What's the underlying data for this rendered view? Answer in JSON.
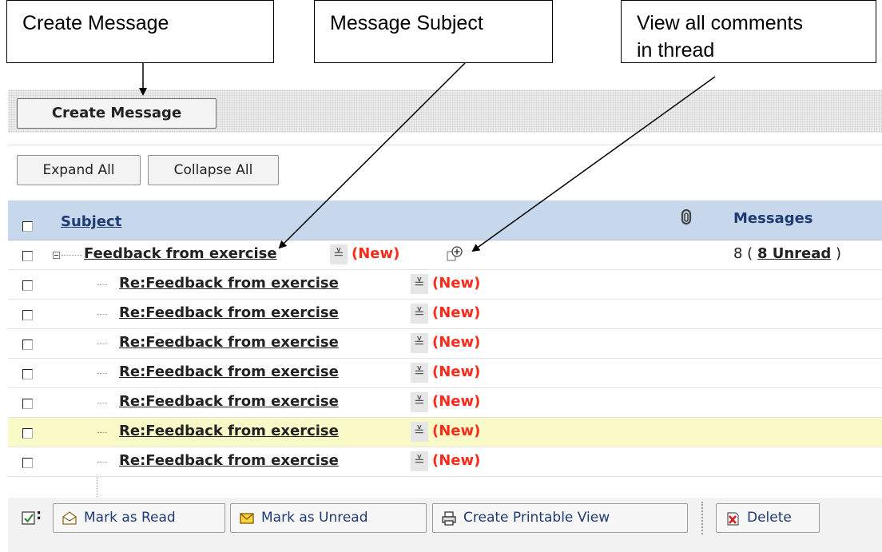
{
  "callouts": {
    "create": "Create Message",
    "subject": "Message Subject",
    "thread_line1": "View all comments",
    "thread_line2": "in thread"
  },
  "toolbar": {
    "create_label": "Create Message",
    "expand_label": "Expand All",
    "collapse_label": "Collapse All"
  },
  "table": {
    "header_subject": "Subject",
    "header_messages": "Messages",
    "attachment_icon": "paperclip-icon",
    "thread": {
      "subject": "Feedback from exercise",
      "new_tag": "(New)",
      "count_prefix": "8 (",
      "unread": "8 Unread",
      "count_suffix": ")"
    },
    "replies": [
      {
        "subject": "Re:Feedback from exercise",
        "new_tag": "(New)"
      },
      {
        "subject": "Re:Feedback from exercise",
        "new_tag": "(New)"
      },
      {
        "subject": "Re:Feedback from exercise",
        "new_tag": "(New)"
      },
      {
        "subject": "Re:Feedback from exercise",
        "new_tag": "(New)"
      },
      {
        "subject": "Re:Feedback from exercise",
        "new_tag": "(New)"
      },
      {
        "subject": "Re:Feedback from exercise",
        "new_tag": "(New)"
      },
      {
        "subject": "Re:Feedback from exercise",
        "new_tag": "(New)"
      }
    ]
  },
  "actions": {
    "mark_read": "Mark as Read",
    "mark_unread": "Mark as Unread",
    "printable": "Create Printable View",
    "delete": "Delete"
  },
  "colors": {
    "header_bg": "#c8d8ec",
    "new_tag": "#ff2a1a",
    "highlight_row": "#fafac8",
    "link_blue": "#1f3b73"
  }
}
